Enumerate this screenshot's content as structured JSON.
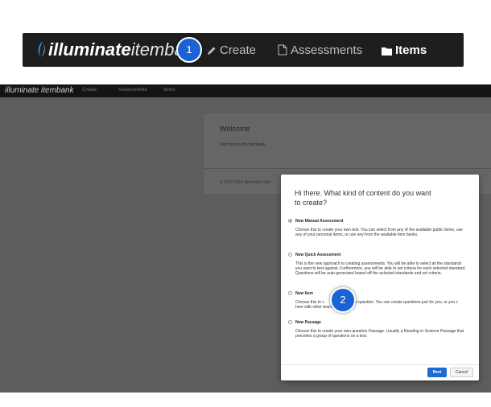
{
  "zoom_nav": {
    "brand_bold": "illuminate",
    "brand_light": "itemba",
    "badge": "1",
    "create": "Create",
    "assessments": "Assessments",
    "items": "Items"
  },
  "mini_nav": {
    "brand": "illuminate itembank",
    "create": "Create",
    "assessments": "Assessments",
    "items": "Items"
  },
  "welcome": {
    "title": "Welcome",
    "subtitle": "Welcome to the Itembank"
  },
  "footer": "© 2012-2015 Illuminate Item",
  "modal": {
    "heading": "Hi there. What kind of content do you want to create?",
    "badge": "2",
    "options": [
      {
        "label": "New Manual Assessment",
        "checked": true,
        "desc": "Choose this to create your own test. You can select from any of the available public items, use any of your personal items, or use any from the available item banks."
      },
      {
        "label": "New Quick Assessment",
        "checked": false,
        "desc": "This is the new approach to creating assessments. You will be able to select all the standards you want to test against. Furthermore, you will be able to set criteria for each selected standard. Questions will be auto generated based off the selected standards and set criteria."
      },
      {
        "label": "New Item",
        "checked": false,
        "desc": "Choose this to c                own test question. You can create questions just for you, or you c              hem with other teachers."
      },
      {
        "label": "New Passage",
        "checked": false,
        "desc": "Choose this to create your own question Passage. Usually a Reading or Science Passage that precedes a group of questions on a test."
      }
    ],
    "next": "Next",
    "cancel": "Cancel"
  }
}
